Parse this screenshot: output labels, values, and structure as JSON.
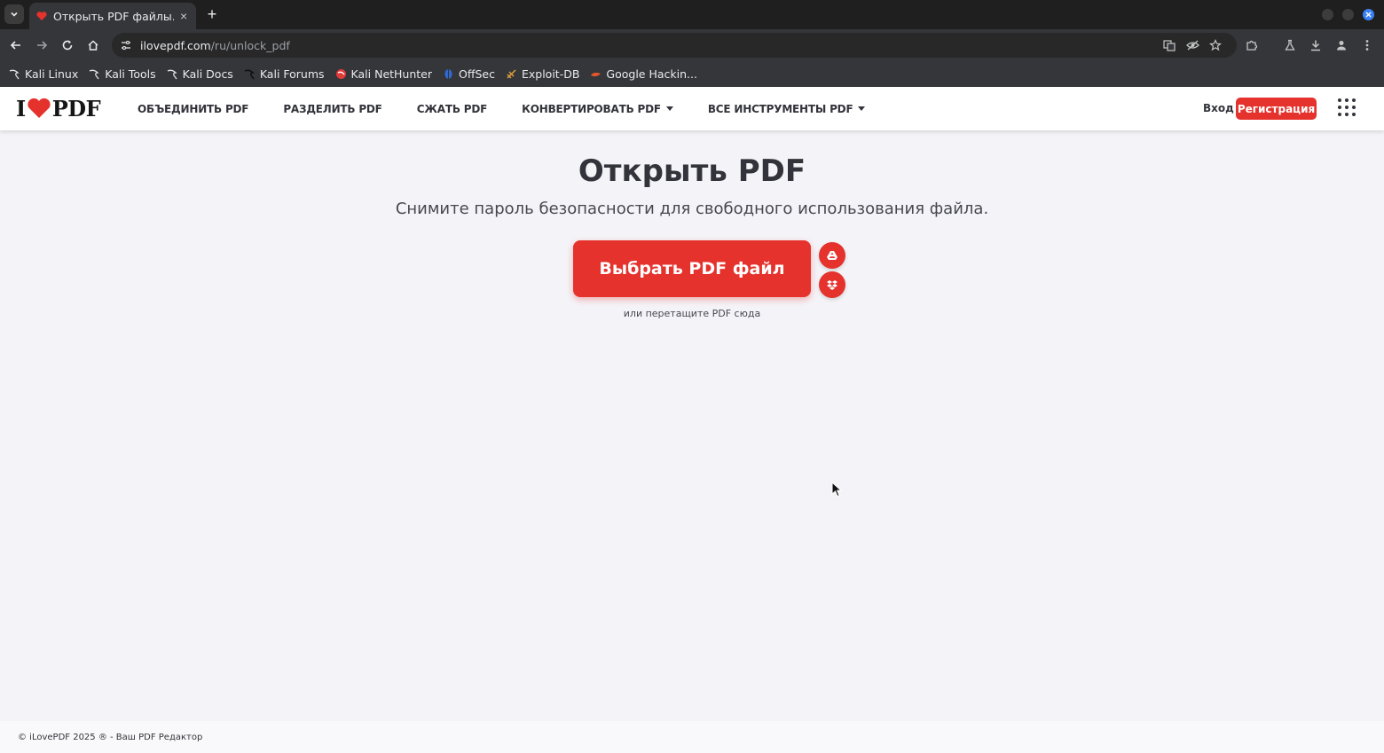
{
  "browser": {
    "tab_title": "Открыть PDF файлы. Ус",
    "new_tab_label": "+",
    "tab_close_label": "×",
    "url_host": "ilovepdf.com",
    "url_path": "/ru/unlock_pdf",
    "bookmarks": [
      {
        "label": "Kali Linux",
        "icon": "kali-dragon-icon"
      },
      {
        "label": "Kali Tools",
        "icon": "kali-dragon-icon"
      },
      {
        "label": "Kali Docs",
        "icon": "kali-dragon-icon"
      },
      {
        "label": "Kali Forums",
        "icon": "kali-dragon-icon"
      },
      {
        "label": "Kali NetHunter",
        "icon": "nethunter-icon"
      },
      {
        "label": "OffSec",
        "icon": "offsec-icon"
      },
      {
        "label": "Exploit-DB",
        "icon": "exploit-db-icon"
      },
      {
        "label": "Google Hackin...",
        "icon": "ghdb-icon"
      }
    ]
  },
  "site": {
    "logo_left": "I",
    "logo_right": "PDF",
    "nav": [
      {
        "label": "ОБЪЕДИНИТЬ PDF",
        "dropdown": false
      },
      {
        "label": "РАЗДЕЛИТЬ PDF",
        "dropdown": false
      },
      {
        "label": "СЖАТЬ PDF",
        "dropdown": false
      },
      {
        "label": "КОНВЕРТИРОВАТЬ PDF",
        "dropdown": true
      },
      {
        "label": "ВСЕ ИНСТРУМЕНТЫ PDF",
        "dropdown": true
      }
    ],
    "login_label": "Вход",
    "register_label": "Регистрация"
  },
  "main": {
    "title": "Открыть PDF",
    "subtitle": "Снимите пароль безопасности для свободного использования файла.",
    "select_button": "Выбрать PDF файл",
    "drop_hint": "или перетащите PDF сюда"
  },
  "footer": {
    "text": "© iLovePDF 2025 ® - Ваш PDF Редактор"
  },
  "colors": {
    "brand_red": "#e5322d",
    "text_dark": "#33333b",
    "page_bg": "#f4f4f8"
  }
}
